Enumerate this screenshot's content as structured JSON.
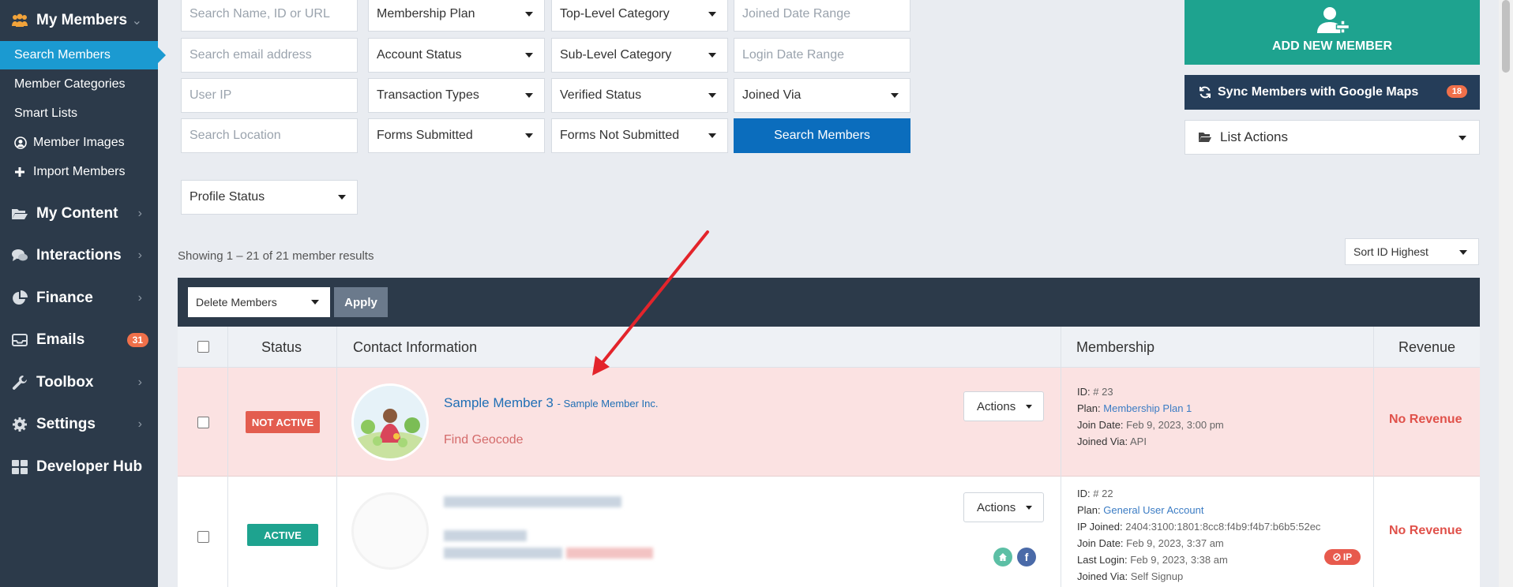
{
  "sidebar": {
    "my_members": "My Members",
    "sub_items": [
      {
        "label": "Search Members"
      },
      {
        "label": "Member Categories"
      },
      {
        "label": "Smart Lists"
      },
      {
        "label": "Member Images"
      },
      {
        "label": "Import Members"
      }
    ],
    "main_items": [
      {
        "label": "My Content"
      },
      {
        "label": "Interactions"
      },
      {
        "label": "Finance"
      },
      {
        "label": "Emails",
        "badge": "31"
      },
      {
        "label": "Toolbox"
      },
      {
        "label": "Settings"
      },
      {
        "label": "Developer Hub"
      }
    ]
  },
  "filters": {
    "search_name_placeholder": "Search Name, ID or URL",
    "search_email_placeholder": "Search email address",
    "user_ip_placeholder": "User IP",
    "search_location_placeholder": "Search Location",
    "membership_plan": "Membership Plan",
    "account_status": "Account Status",
    "transaction_types": "Transaction Types",
    "forms_submitted": "Forms Submitted",
    "top_level_category": "Top-Level Category",
    "sub_level_category": "Sub-Level Category",
    "verified_status": "Verified Status",
    "forms_not_submitted": "Forms Not Submitted",
    "joined_date_range_placeholder": "Joined Date Range",
    "login_date_range_placeholder": "Login Date Range",
    "joined_via": "Joined Via",
    "search_button": "Search Members",
    "profile_status": "Profile Status"
  },
  "right_panel": {
    "add_new_member": "ADD NEW MEMBER",
    "sync_label": "Sync Members with Google Maps",
    "sync_badge": "18",
    "list_actions": "List Actions"
  },
  "results": {
    "showing": "Showing 1 – 21 of 21 member results",
    "sort": "Sort ID Highest",
    "bulk_action": "Delete Members",
    "apply": "Apply"
  },
  "table": {
    "headers": {
      "status": "Status",
      "contact": "Contact Information",
      "membership": "Membership",
      "revenue": "Revenue"
    },
    "rows": [
      {
        "status": "NOT ACTIVE",
        "name": "Sample Member 3",
        "company": "- Sample Member Inc.",
        "geocode": "Find Geocode",
        "actions": "Actions",
        "id_label": "ID:",
        "id": "# 23",
        "plan_label": "Plan:",
        "plan": "Membership Plan 1",
        "join_label": "Join Date:",
        "join_date": "Feb 9, 2023, 3:00 pm",
        "via_label": "Joined Via:",
        "via": "API",
        "revenue": "No Revenue"
      },
      {
        "status": "ACTIVE",
        "actions": "Actions",
        "id_label": "ID:",
        "id": "# 22",
        "plan_label": "Plan:",
        "plan": "General User Account",
        "ip_label": "IP Joined:",
        "ip": "2404:3100:1801:8cc8:f4b9:f4b7:b6b5:52ec",
        "ip_badge": "IP",
        "join_label": "Join Date:",
        "join_date": "Feb 9, 2023, 3:37 am",
        "login_label": "Last Login:",
        "login": "Feb 9, 2023, 3:38 am",
        "via_label": "Joined Via:",
        "via": "Self Signup",
        "revenue": "No Revenue"
      }
    ]
  },
  "colors": {
    "sidebar_bg": "#2c3a4a",
    "active_blue": "#1b9ad1",
    "add_member_green": "#1ea38f",
    "sync_navy": "#253d59",
    "not_active_red": "#e35d4f",
    "active_teal": "#1ea38f",
    "annotation_arrow": "#e3242b"
  }
}
